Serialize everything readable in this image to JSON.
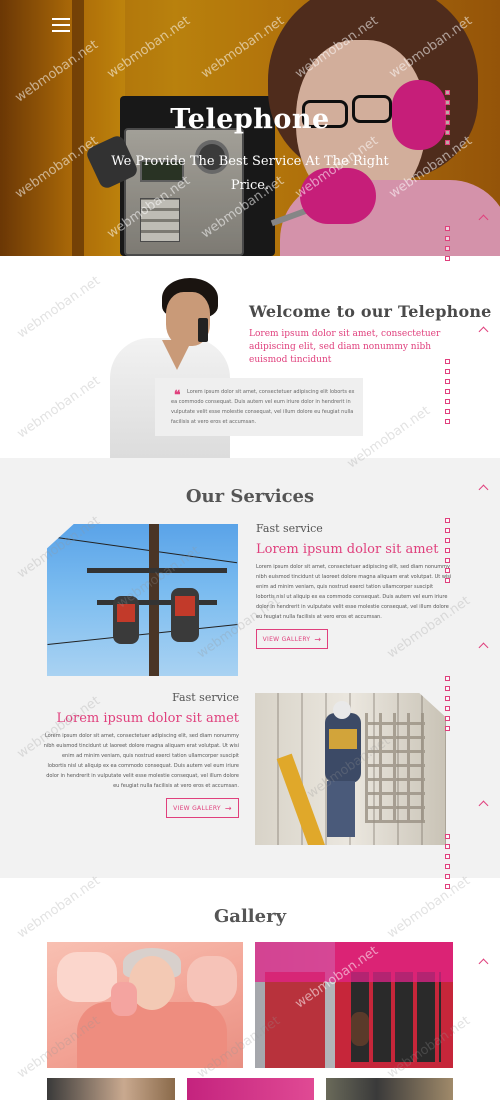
{
  "hero": {
    "title": "Telephone",
    "subtitle": "We Provide The Best Service At The Right Price."
  },
  "welcome": {
    "title": "Welcome to our Telephone",
    "lead": "Lorem ipsum dolor sit amet, consectetuer adipiscing elit, sed diam nonummy nibh euismod tincidunt",
    "quote": "Lorem ipsum dolor sit amet, consectetuer adipiscing elit loborts ex ea commodo consequat. Duis autem vel eum iriure dolor in hendrerit in vulputate velit esse molestie consequat, vel illum dolore eu feugiat nulla facilisis at vero eros et accumsan."
  },
  "services": {
    "title": "Our Services",
    "items": [
      {
        "kicker": "Fast service",
        "heading": "Lorem ipsum dolor sit amet",
        "body": "Lorem ipsum dolor sit amet, consectetuer adipiscing elit, sed diam nonummy nibh euismod tincidunt ut laoreet dolore magna aliquam erat volutpat. Ut wisi enim ad minim veniam, quis nostrud exerci tation ullamcorper suscipit lobortis nisl ut aliquip ex ea commodo consequat. Duis autem vel eum iriure dolor in hendrerit in vulputate velit esse molestie consequat, vel illum dolore eu feugiat nulla facilisis at vero eros et accumsan.",
        "button": "VIEW GALLERY"
      },
      {
        "kicker": "Fast service",
        "heading": "Lorem ipsum dolor sit amet",
        "body": "Lorem ipsum dolor sit amet, consectetuer adipiscing elit, sed diam nonummy nibh euismod tincidunt ut laoreet dolore magna aliquam erat volutpat. Ut wisi enim ad minim veniam, quis nostrud exerci tation ullamcorper suscipit lobortis nisl ut aliquip ex ea commodo consequat. Duis autem vel eum iriure dolor in hendrerit in vulputate velit esse molestie consequat, vel illum dolore eu feugiat nulla facilisis at vero eros et accumsan.",
        "button": "VIEW GALLERY"
      }
    ]
  },
  "gallery": {
    "title": "Gallery"
  },
  "watermark": "webmoban.net",
  "icons": {
    "menu": "hamburger-menu-icon",
    "arrow": "arrow-right-icon",
    "quote": "quote-icon",
    "scroll_top": "chevron-up-icon"
  },
  "colors": {
    "accent": "#e0407d",
    "section_gray": "#f2f2f2",
    "quote_box": "#efefef"
  }
}
